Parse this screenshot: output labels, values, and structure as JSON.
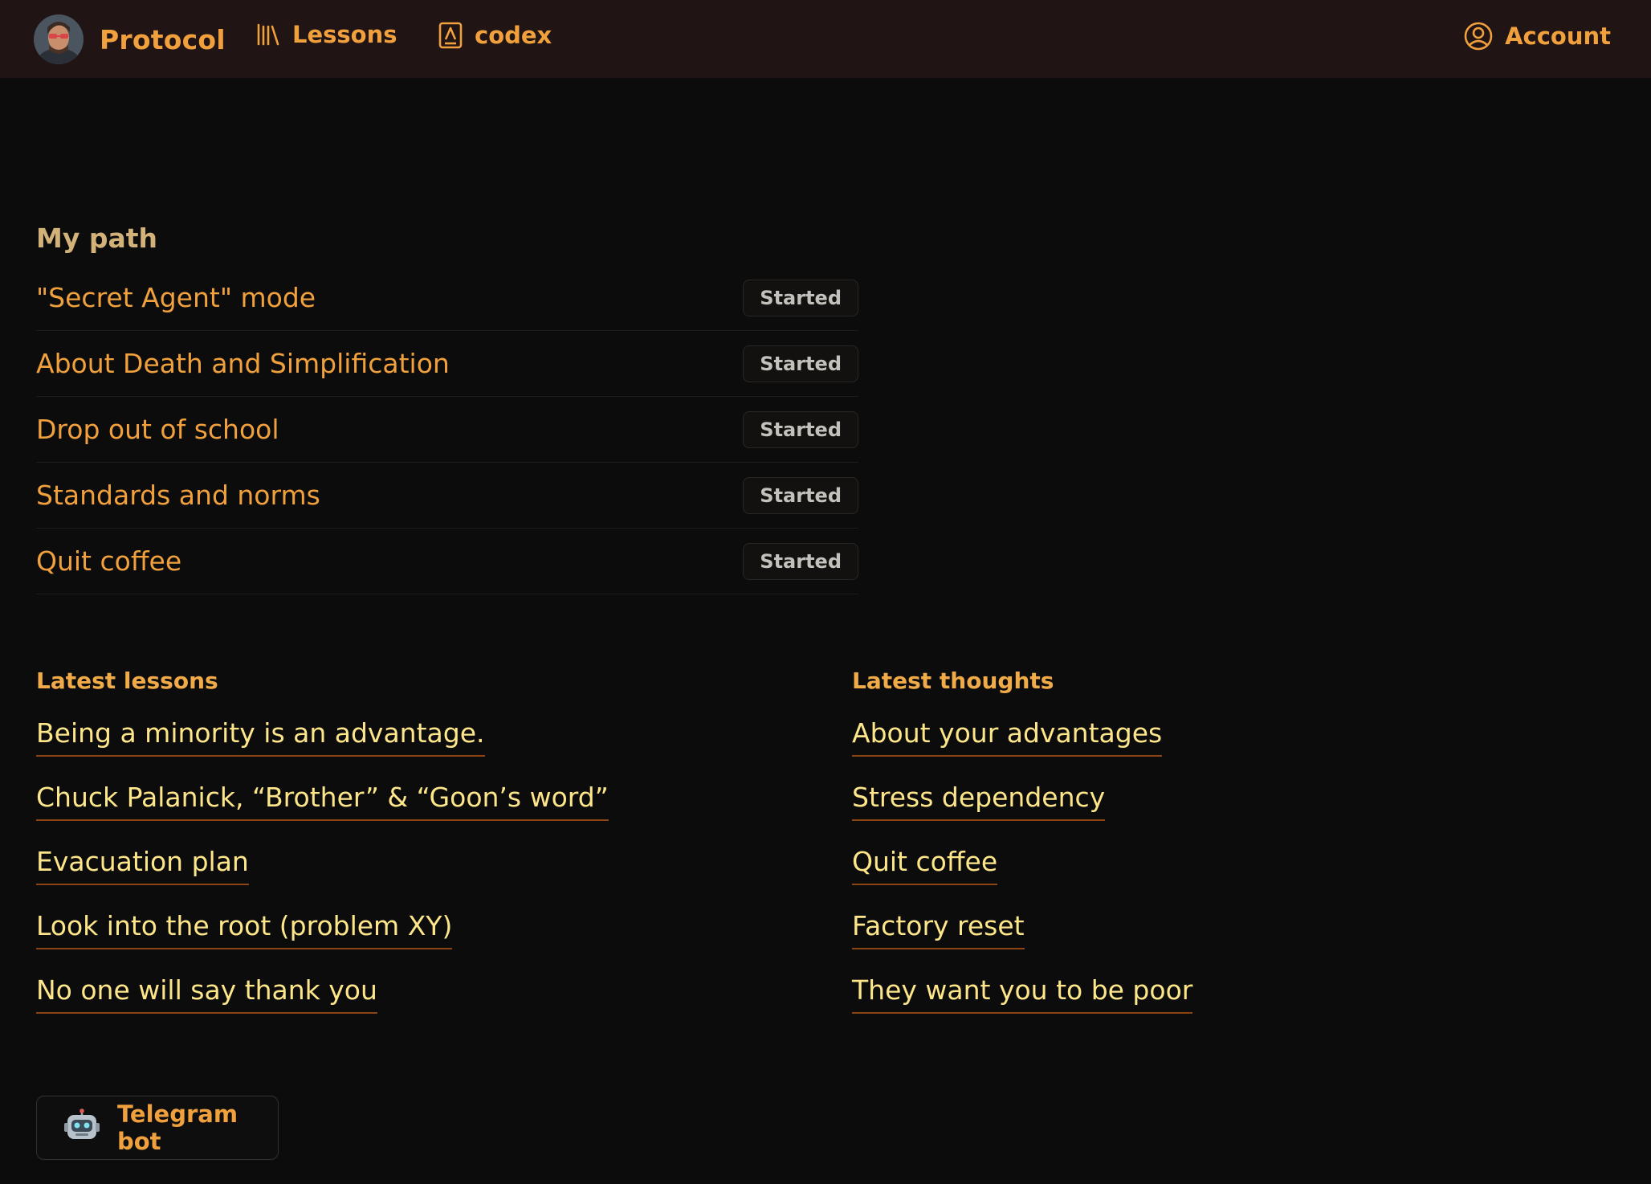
{
  "header": {
    "brand": "Protocol",
    "nav": {
      "lessons": "Lessons",
      "codex": "codex",
      "account": "Account"
    }
  },
  "my_path": {
    "title": "My path",
    "items": [
      {
        "label": "\"Secret Agent\" mode",
        "status": "Started"
      },
      {
        "label": "About Death and Simplification",
        "status": "Started"
      },
      {
        "label": "Drop out of school",
        "status": "Started"
      },
      {
        "label": "Standards and norms",
        "status": "Started"
      },
      {
        "label": "Quit coffee",
        "status": "Started"
      }
    ]
  },
  "latest_lessons": {
    "title": "Latest lessons",
    "items": [
      "Being a minority is an advantage.",
      "Chuck Palanick, “Brother” & “Goon’s word”",
      "Evacuation plan",
      "Look into the root (problem XY)",
      "No one will say thank you"
    ]
  },
  "latest_thoughts": {
    "title": "Latest thoughts",
    "items": [
      "About your advantages",
      "Stress dependency",
      "Quit coffee",
      "Factory reset",
      "They want you to be poor"
    ]
  },
  "footer": {
    "telegram_label": "Telegram bot"
  },
  "colors": {
    "accent": "#f0a03c",
    "link_text": "#fde68a",
    "background": "#0d0c0c",
    "header_bg": "#201414"
  }
}
